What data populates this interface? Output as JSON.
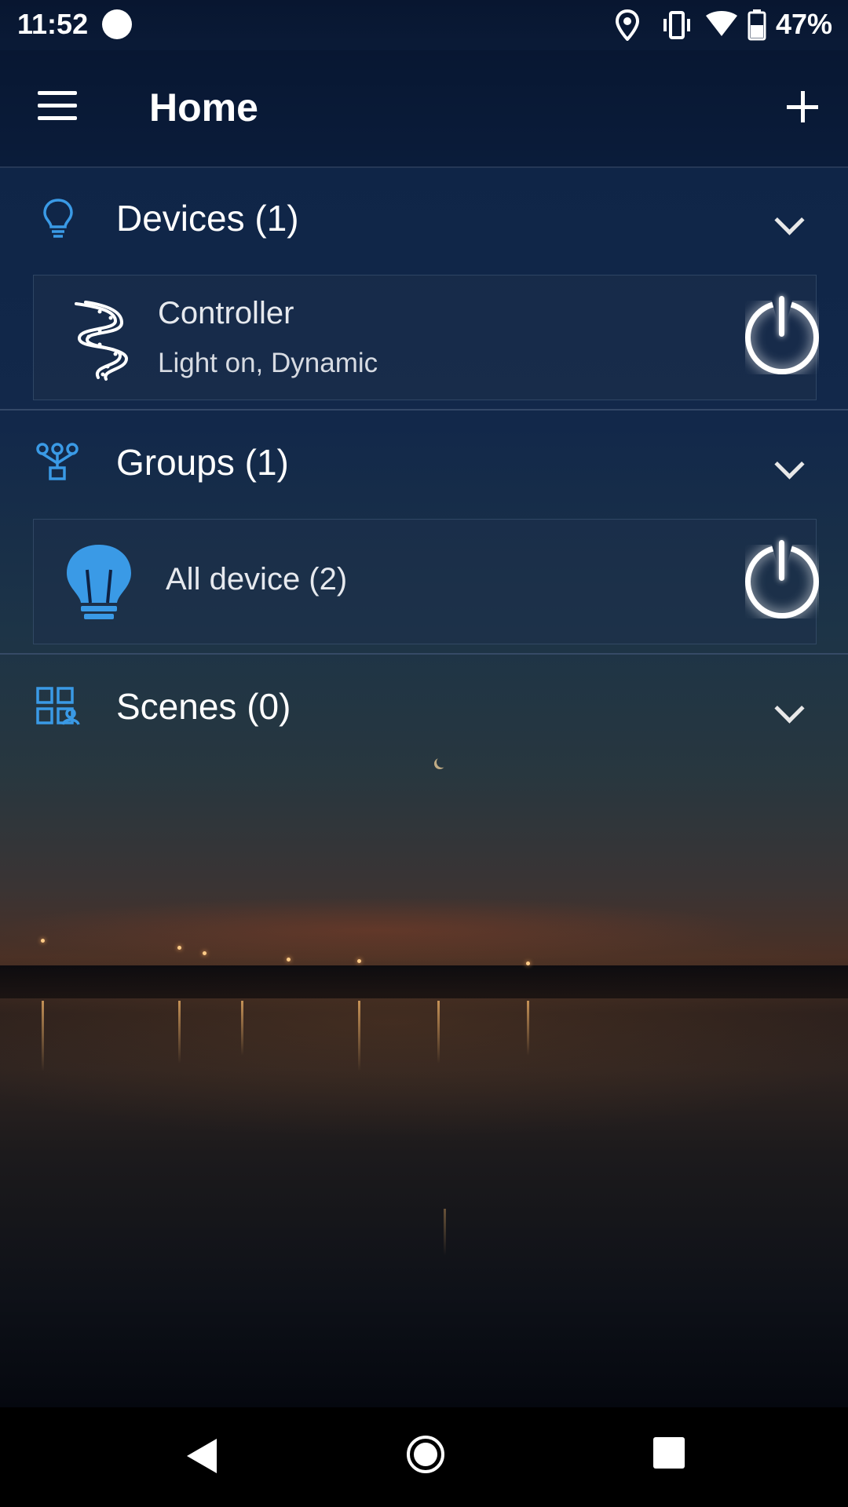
{
  "status_bar": {
    "time": "11:52",
    "battery_percent": "47%",
    "icons": [
      "notification-dot-icon",
      "location-icon",
      "vibrate-icon",
      "wifi-icon",
      "battery-icon"
    ]
  },
  "app_bar": {
    "title": "Home",
    "menu_icon": "hamburger-menu-icon",
    "add_icon": "plus-icon"
  },
  "sections": {
    "devices": {
      "label": "Devices (1)",
      "icon": "bulb-outline-icon",
      "expanded": true,
      "items": [
        {
          "name": "Controller",
          "status": "Light on, Dynamic",
          "icon": "led-strip-icon",
          "power_icon": "power-icon"
        }
      ]
    },
    "groups": {
      "label": "Groups (1)",
      "icon": "group-nodes-icon",
      "expanded": true,
      "items": [
        {
          "name": "All device (2)",
          "icon": "bulb-filled-icon",
          "power_icon": "power-icon"
        }
      ]
    },
    "scenes": {
      "label": "Scenes (0)",
      "icon": "scenes-grid-icon",
      "expanded": true
    }
  },
  "colors": {
    "accent": "#3a9ae6",
    "text": "#ffffff",
    "nav_bar": "#000000"
  },
  "nav_bar": {
    "icons": [
      "back-icon",
      "home-icon",
      "recents-icon"
    ]
  }
}
